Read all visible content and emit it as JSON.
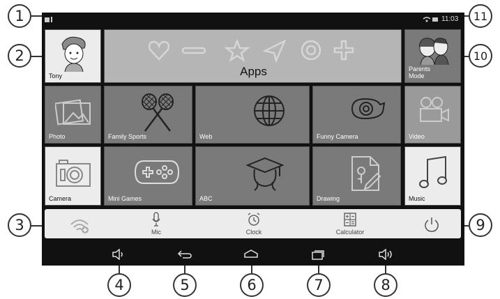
{
  "status_bar": {
    "time": "11:03"
  },
  "tiles": {
    "profile": {
      "label": "Tony"
    },
    "apps": {
      "label": "Apps"
    },
    "parents": {
      "label": "Parents\nMode"
    },
    "photo": {
      "label": "Photo"
    },
    "family_sports": {
      "label": "Family Sports"
    },
    "web": {
      "label": "Web"
    },
    "funny_camera": {
      "label": "Funny Camera"
    },
    "video": {
      "label": "Video"
    },
    "camera": {
      "label": "Camera"
    },
    "mini_games": {
      "label": "Mini Games"
    },
    "abc": {
      "label": "ABC"
    },
    "drawing": {
      "label": "Drawing"
    },
    "music": {
      "label": "Music"
    }
  },
  "dock": {
    "mic": "Mic",
    "clock": "Clock",
    "calculator": "Calculator"
  },
  "callouts": [
    "1",
    "2",
    "3",
    "4",
    "5",
    "6",
    "7",
    "8",
    "9",
    "10",
    "11"
  ],
  "colors": {
    "screen": "#111111",
    "tile_dark": "#7a7a7a",
    "tile_light": "#ececec",
    "tile_apps": "#b5b5b5"
  }
}
